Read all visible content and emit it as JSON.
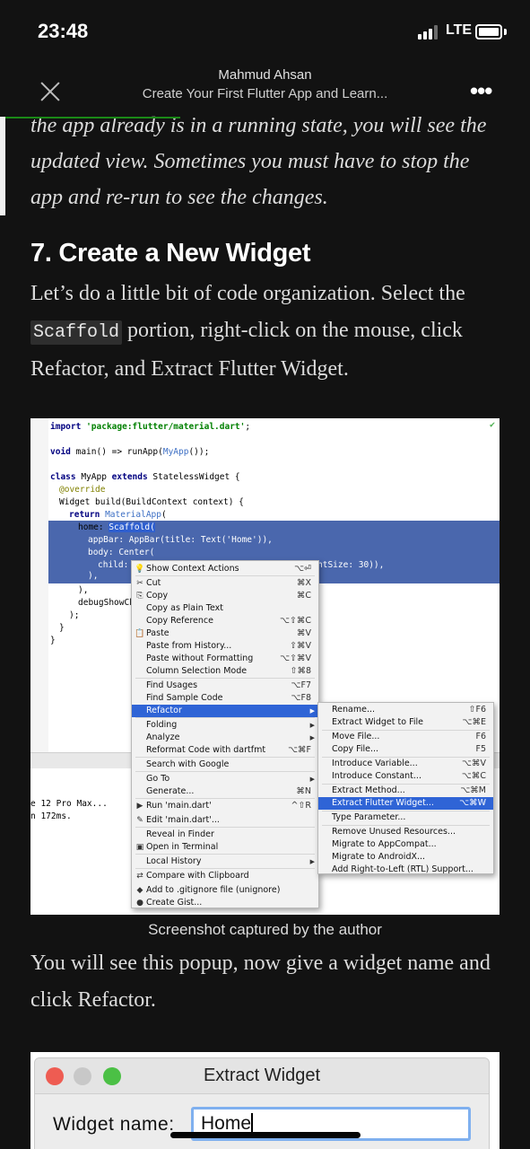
{
  "status_bar": {
    "time": "23:48",
    "network": "LTE",
    "signal_bars": 3,
    "signal_bars_total": 4
  },
  "header": {
    "author": "Mahmud Ahsan",
    "title": "Create Your First Flutter App and Learn...",
    "more_label": "•••",
    "reading_progress": 0.34
  },
  "article": {
    "intro_italic": "the app already is in a running state, you will see the updated view. Sometimes you must have to stop the app and re-run to see the changes.",
    "heading": "7. Create a New Widget",
    "para1_before": "Let’s do a little bit of code organization. Select the ",
    "para1_code": "Scaffold",
    "para1_after": " portion, right-click on the mouse, click Refactor, and Extract Flutter Widget.",
    "caption": "Screenshot captured by the author",
    "para2": "You will see this popup, now give a widget name and click Refactor."
  },
  "ide": {
    "code": {
      "import_kw": "import",
      "import_str": "'package:flutter/material.dart'",
      "import_end": ";",
      "main_kw": "void",
      "main_rest": " main() => runApp(",
      "main_cls": "MyApp",
      "main_end": "());",
      "class_kw": "class",
      "class_name": " MyApp ",
      "extends_kw": "extends",
      "class_rest": " StatelessWidget {",
      "override": "@override",
      "build_line": "Widget build(BuildContext context) {",
      "return_kw": "return",
      "return_cls": "MaterialApp",
      "return_end": "(",
      "home_line": "home: ",
      "home_sel": "Scaffold(",
      "appbar_line": "appBar: AppBar(title: Text('Home')),",
      "body_line": "body: Center(",
      "child_line": "child:",
      "child_tail": "ntSize: 30)),",
      "close1": "),",
      "close2": "),",
      "debug_line": "debugShowCh",
      "close3": ");",
      "close4": "}",
      "close5": "}",
      "run_device": "e 12 Pro Max...",
      "run_time": "n 172ms."
    },
    "context_menu": [
      {
        "icon": "bulb-icon",
        "glyph": "💡",
        "label": "Show Context Actions",
        "shortcut": "⌥⏎"
      },
      {
        "icon": "cut-icon",
        "glyph": "✂",
        "label": "Cut",
        "shortcut": "⌘X"
      },
      {
        "icon": "copy-icon",
        "glyph": "⎘",
        "label": "Copy",
        "shortcut": "⌘C"
      },
      {
        "icon": "",
        "glyph": "",
        "label": "Copy as Plain Text",
        "shortcut": ""
      },
      {
        "icon": "",
        "glyph": "",
        "label": "Copy Reference",
        "shortcut": "⌥⇧⌘C"
      },
      {
        "icon": "paste-icon",
        "glyph": "📋",
        "label": "Paste",
        "shortcut": "⌘V"
      },
      {
        "icon": "",
        "glyph": "",
        "label": "Paste from History...",
        "shortcut": "⇧⌘V"
      },
      {
        "icon": "",
        "glyph": "",
        "label": "Paste without Formatting",
        "shortcut": "⌥⇧⌘V"
      },
      {
        "icon": "",
        "glyph": "",
        "label": "Column Selection Mode",
        "shortcut": "⇧⌘8"
      },
      {
        "icon": "",
        "glyph": "",
        "label": "Find Usages",
        "shortcut": "⌥F7"
      },
      {
        "icon": "",
        "glyph": "",
        "label": "Find Sample Code",
        "shortcut": "⌥F8"
      },
      {
        "icon": "",
        "glyph": "",
        "label": "Refactor",
        "shortcut": "",
        "submenu": true,
        "active": true
      },
      {
        "icon": "",
        "glyph": "",
        "label": "Folding",
        "shortcut": "",
        "submenu": true
      },
      {
        "icon": "",
        "glyph": "",
        "label": "Analyze",
        "shortcut": "",
        "submenu": true
      },
      {
        "icon": "",
        "glyph": "",
        "label": "Reformat Code with dartfmt",
        "shortcut": "⌥⌘F"
      },
      {
        "icon": "",
        "glyph": "",
        "label": "Search with Google",
        "shortcut": ""
      },
      {
        "icon": "",
        "glyph": "",
        "label": "Go To",
        "shortcut": "",
        "submenu": true
      },
      {
        "icon": "",
        "glyph": "",
        "label": "Generate...",
        "shortcut": "⌘N"
      },
      {
        "icon": "run-icon",
        "glyph": "▶",
        "label": "Run 'main.dart'",
        "shortcut": "^⇧R"
      },
      {
        "icon": "edit-icon",
        "glyph": "✎",
        "label": "Edit 'main.dart'...",
        "shortcut": ""
      },
      {
        "icon": "",
        "glyph": "",
        "label": "Reveal in Finder",
        "shortcut": ""
      },
      {
        "icon": "terminal-icon",
        "glyph": "▣",
        "label": "Open in Terminal",
        "shortcut": ""
      },
      {
        "icon": "",
        "glyph": "",
        "label": "Local History",
        "shortcut": "",
        "submenu": true
      },
      {
        "icon": "compare-icon",
        "glyph": "⇄",
        "label": "Compare with Clipboard",
        "shortcut": ""
      },
      {
        "icon": "git-icon",
        "glyph": "◆",
        "label": "Add to .gitignore file (unignore)",
        "shortcut": ""
      },
      {
        "icon": "github-icon",
        "glyph": "●",
        "label": "Create Gist...",
        "shortcut": ""
      }
    ],
    "refactor_submenu": [
      {
        "label": "Rename...",
        "shortcut": "⇧F6"
      },
      {
        "label": "Extract Widget to File",
        "shortcut": "⌥⌘E"
      },
      {
        "label": "Move File...",
        "shortcut": "F6"
      },
      {
        "label": "Copy File...",
        "shortcut": "F5"
      },
      {
        "label": "Introduce Variable...",
        "shortcut": "⌥⌘V"
      },
      {
        "label": "Introduce Constant...",
        "shortcut": "⌥⌘C"
      },
      {
        "label": "Extract Method...",
        "shortcut": "⌥⌘M"
      },
      {
        "label": "Extract Flutter Widget...",
        "shortcut": "⌥⌘W",
        "active": true
      },
      {
        "label": "Type Parameter...",
        "shortcut": ""
      },
      {
        "label": "Remove Unused Resources...",
        "shortcut": ""
      },
      {
        "label": "Migrate to AppCompat...",
        "shortcut": ""
      },
      {
        "label": "Migrate to AndroidX...",
        "shortcut": ""
      },
      {
        "label": "Add Right-to-Left (RTL) Support...",
        "shortcut": ""
      }
    ]
  },
  "dialog": {
    "title": "Extract Widget",
    "field_label": "Widget name:",
    "field_value": "Home"
  }
}
